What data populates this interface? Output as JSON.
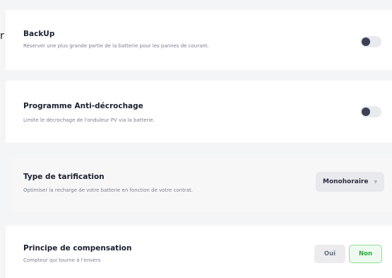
{
  "stray_char": "r",
  "backup": {
    "title": "BackUp",
    "description": "Réserver une plus grande partie de la batterie pour les pannes de courant.",
    "enabled": false
  },
  "anti_clipping": {
    "title": "Programme Anti-décrochage",
    "description": "Limite le décrochage de l'onduleur PV via la batterie.",
    "enabled": false
  },
  "tariff": {
    "title": "Type de tarification",
    "description": "Optimiser la recharge de votre batterie en fonction de votre contrat.",
    "selected": "Monohoraire"
  },
  "compensation": {
    "title": "Principe de compensation",
    "description": "Compteur qui tourne à l'envers",
    "options": [
      "Oui",
      "Non"
    ],
    "selected": "Non"
  },
  "colors": {
    "accent_green": "#2fa83f",
    "toggle_knob": "#3b4154"
  }
}
